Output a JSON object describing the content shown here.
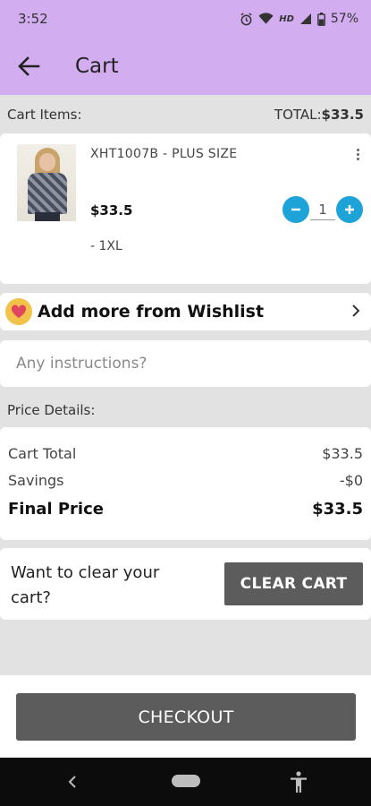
{
  "status_bar": {
    "time": "3:52",
    "hd": "HD",
    "battery": "57%"
  },
  "app_bar": {
    "title": "Cart"
  },
  "cart_summary": {
    "label": "Cart Items:",
    "total_label": "TOTAL:",
    "total_value": "$33.5"
  },
  "cart_items": [
    {
      "name": "XHT1007B - PLUS SIZE",
      "price": "$33.5",
      "size": "- 1XL",
      "quantity": "1"
    }
  ],
  "wishlist": {
    "label": "Add more from Wishlist"
  },
  "instructions": {
    "placeholder": "Any instructions?"
  },
  "price_details": {
    "label": "Price Details:",
    "cart_total_label": "Cart Total",
    "cart_total_value": "$33.5",
    "savings_label": "Savings",
    "savings_value": "-$0",
    "final_label": "Final Price",
    "final_value": "$33.5"
  },
  "clear_cart": {
    "prompt": "Want to clear your cart?",
    "button": "CLEAR CART"
  },
  "checkout": {
    "button": "CHECKOUT"
  },
  "colors": {
    "app_bar": "#d2aef0",
    "accent": "#1ea3d8",
    "button": "#5c5c5c",
    "wishlist_badge": "#f3c24a"
  }
}
